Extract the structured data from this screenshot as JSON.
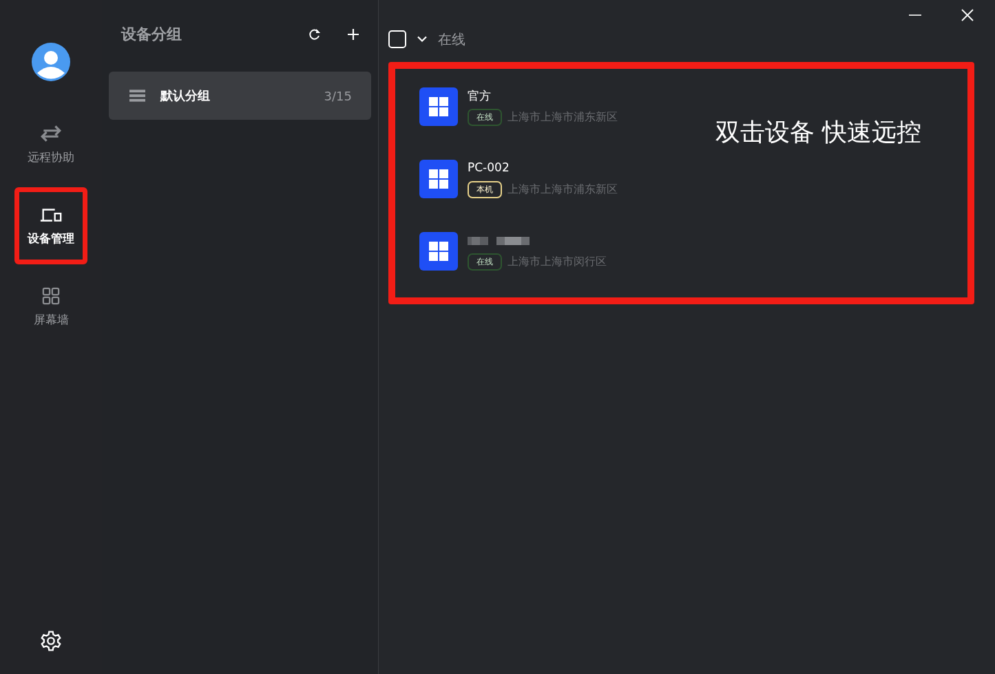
{
  "window": {
    "controls": [
      {
        "kind": "minimize"
      },
      {
        "kind": "close"
      }
    ]
  },
  "nav": {
    "items": [
      {
        "kind": "swap",
        "label": "远程协助",
        "selected": false,
        "highlighted": false
      },
      {
        "kind": "devices",
        "label": "设备管理",
        "selected": true,
        "highlighted": true
      },
      {
        "kind": "grid",
        "label": "屏幕墙",
        "selected": false,
        "highlighted": false
      }
    ]
  },
  "groups": {
    "title": "设备分组",
    "items": [
      {
        "label": "默认分组",
        "count": "3/15",
        "selected": true
      }
    ]
  },
  "filter": {
    "checked": false,
    "label": "在线"
  },
  "devices": {
    "highlighted": true,
    "annotation": "双击设备 快速远控",
    "items": [
      {
        "name": "官方",
        "redacted": false,
        "tag": {
          "kind": "online",
          "label": "在线"
        },
        "location": "上海市上海市浦东新区"
      },
      {
        "name": "PC-002",
        "redacted": false,
        "tag": {
          "kind": "local",
          "label": "本机"
        },
        "location": "上海市上海市浦东新区"
      },
      {
        "redacted": true,
        "tag": {
          "kind": "online",
          "label": "在线"
        },
        "location": "上海市上海市闵行区"
      }
    ]
  }
}
